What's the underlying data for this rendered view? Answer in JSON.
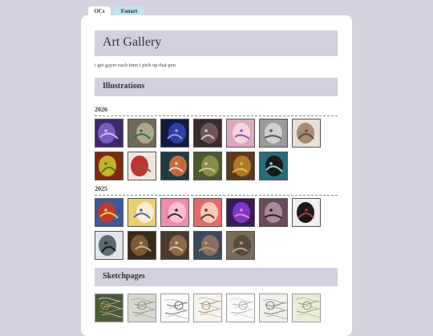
{
  "tabs": [
    {
      "label": "OCs"
    },
    {
      "label": "Fanart"
    }
  ],
  "gallery": {
    "title": "Art Gallery",
    "tagline": "i get gayer each time i pick up that pen"
  },
  "sections": {
    "illustrations": {
      "heading": "Illustrations",
      "years": [
        {
          "label": "2026"
        },
        {
          "label": "2025"
        }
      ]
    },
    "sketchpages": {
      "heading": "Sketchpages"
    }
  },
  "thumbnails": {
    "y2026": [
      {
        "bg": "#3b2a66",
        "fg": "#7a5cc0",
        "accent": "#d7b0f0",
        "icon": "artwork-thumbnail"
      },
      {
        "bg": "#6e6a58",
        "fg": "#b0a78a",
        "accent": "#2d6a55",
        "icon": "artwork-thumbnail"
      },
      {
        "bg": "#101a44",
        "fg": "#2f3f9a",
        "accent": "#8aa0ff",
        "icon": "artwork-thumbnail"
      },
      {
        "bg": "#3a2a2c",
        "fg": "#6d5758",
        "accent": "#d9c5c0",
        "icon": "artwork-thumbnail"
      },
      {
        "bg": "#d9a9bd",
        "fg": "#f6d4e0",
        "accent": "#7a5fa8",
        "icon": "artwork-thumbnail"
      },
      {
        "bg": "#9a9a9a",
        "fg": "#cfcfcf",
        "accent": "#555555",
        "icon": "artwork-thumbnail"
      },
      {
        "bg": "#e8e0d6",
        "fg": "#a98b72",
        "accent": "#5d4a3c",
        "icon": "artwork-thumbnail"
      },
      {
        "bg": "#7e2a10",
        "fg": "#c7b32a",
        "accent": "#3f7a2c",
        "icon": "artwork-thumbnail"
      },
      {
        "bg": "#f1e6de",
        "fg": "#c0332c",
        "accent": "#7a5a4a",
        "icon": "artwork-thumbnail"
      },
      {
        "bg": "#1f3a44",
        "fg": "#c46a3c",
        "accent": "#f1d9c0",
        "icon": "artwork-thumbnail"
      },
      {
        "bg": "#4b5a2a",
        "fg": "#8a8a4a",
        "accent": "#d9c98a",
        "icon": "artwork-thumbnail"
      },
      {
        "bg": "#5a3a1a",
        "fg": "#b07a2a",
        "accent": "#e0c060",
        "icon": "artwork-thumbnail"
      },
      {
        "bg": "#2a6a7a",
        "fg": "#1a1a1a",
        "accent": "#a0d0d8",
        "icon": "artwork-thumbnail"
      }
    ],
    "y2025": [
      {
        "bg": "#3b5a9a",
        "fg": "#c03a2a",
        "accent": "#f0d050",
        "icon": "artwork-thumbnail"
      },
      {
        "bg": "#e8d070",
        "fg": "#f6efd6",
        "accent": "#4a6a9a",
        "icon": "artwork-thumbnail"
      },
      {
        "bg": "#f08ab0",
        "fg": "#f9c0d4",
        "accent": "#2a2a2a",
        "icon": "artwork-thumbnail"
      },
      {
        "bg": "#e06a6a",
        "fg": "#f7c9b6",
        "accent": "#5a3a3a",
        "icon": "artwork-thumbnail"
      },
      {
        "bg": "#3a1a5a",
        "fg": "#7a3ac0",
        "accent": "#f07ad0",
        "icon": "artwork-thumbnail"
      },
      {
        "bg": "#6a4a5a",
        "fg": "#a88a9a",
        "accent": "#2a1a2a",
        "icon": "artwork-thumbnail"
      },
      {
        "bg": "#f0f0f0",
        "fg": "#1a1a1a",
        "accent": "#c03a3a",
        "icon": "artwork-thumbnail"
      },
      {
        "bg": "#e0e6ea",
        "fg": "#5a6a70",
        "accent": "#1a1a1a",
        "icon": "artwork-thumbnail"
      },
      {
        "bg": "#3a2a1a",
        "fg": "#7a5a3a",
        "accent": "#d0b08a",
        "icon": "artwork-thumbnail"
      },
      {
        "bg": "#4a3a2a",
        "fg": "#8a6a4a",
        "accent": "#e0c09a",
        "icon": "artwork-thumbnail"
      },
      {
        "bg": "#3a4a5a",
        "fg": "#8a7060",
        "accent": "#c09a7a",
        "icon": "artwork-thumbnail"
      },
      {
        "bg": "#7a6a5a",
        "fg": "#5a4a3a",
        "accent": "#c0a08a",
        "icon": "artwork-thumbnail"
      }
    ],
    "sketch": [
      {
        "bg": "#4a5a3a",
        "fg": "#c0a060",
        "accent": "#e0e0d0",
        "icon": "sketch-thumbnail"
      },
      {
        "bg": "#d8d8d0",
        "fg": "#7a7a70",
        "accent": "#a0a098",
        "icon": "sketch-thumbnail"
      },
      {
        "bg": "#fafafa",
        "fg": "#4a4a4a",
        "accent": "#b0b0b0",
        "icon": "sketch-thumbnail"
      },
      {
        "bg": "#f6f4ee",
        "fg": "#8a7a5a",
        "accent": "#c0b090",
        "icon": "sketch-thumbnail"
      },
      {
        "bg": "#fafafa",
        "fg": "#9a9a9a",
        "accent": "#cfcfcf",
        "icon": "sketch-thumbnail"
      },
      {
        "bg": "#f0f0ec",
        "fg": "#5a5a5a",
        "accent": "#a0a0a0",
        "icon": "sketch-thumbnail"
      },
      {
        "bg": "#e8ecd8",
        "fg": "#7a8a5a",
        "accent": "#b0b890",
        "icon": "sketch-thumbnail"
      }
    ]
  }
}
